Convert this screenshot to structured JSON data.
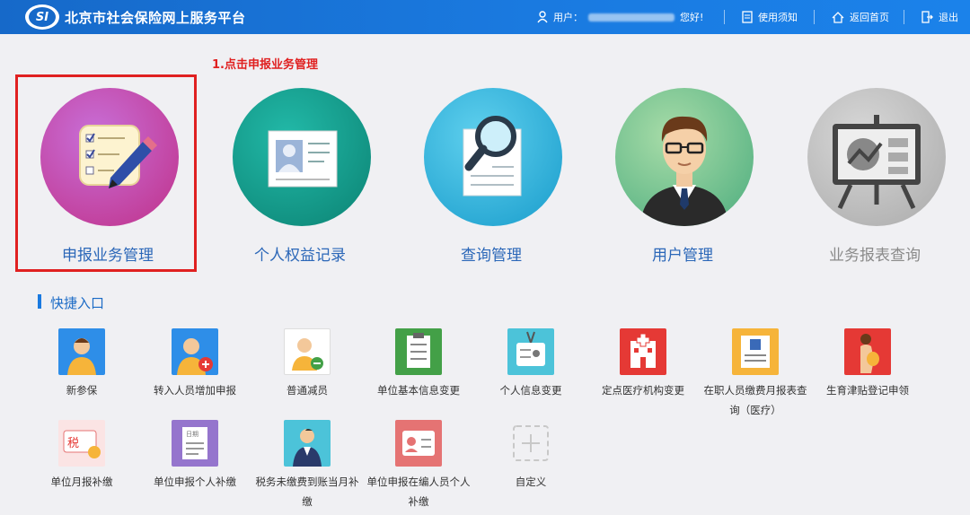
{
  "header": {
    "logo_text": "SI",
    "title": "北京市社会保险网上服务平台",
    "user_label": "用户：",
    "greeting": "您好!",
    "links": [
      "使用须知",
      "返回首页",
      "退出"
    ]
  },
  "annotation": "1.点击申报业务管理",
  "main_tiles": [
    {
      "label": "申报业务管理",
      "color": "#c65bc9"
    },
    {
      "label": "个人权益记录",
      "color": "#1aa89a"
    },
    {
      "label": "查询管理",
      "color": "#3cb8dc"
    },
    {
      "label": "用户管理",
      "color": "#7ac79a"
    },
    {
      "label": "业务报表查询",
      "color": "#c2c2c2"
    }
  ],
  "quick": {
    "title": "快捷入口",
    "row1": [
      "新参保",
      "转入人员增加申报",
      "普通减员",
      "单位基本信息变更",
      "个人信息变更",
      "定点医疗机构变更",
      "在职人员缴费月报表查询（医疗）",
      "生育津贴登记申领"
    ],
    "row2": [
      "单位月报补缴",
      "单位申报个人补缴",
      "税务未缴费到账当月补缴",
      "单位申报在编人员个人补缴",
      "自定义"
    ],
    "icon_chars": {
      "tax": "税",
      "date": "日期"
    }
  },
  "colors": {
    "accent": "#1a7ae0",
    "highlight": "#e02020"
  }
}
